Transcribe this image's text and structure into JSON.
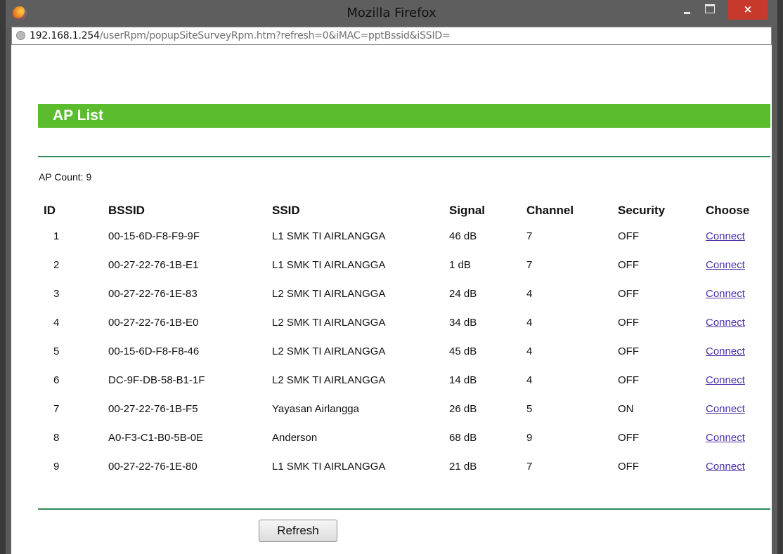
{
  "window": {
    "title": "Mozilla Firefox",
    "close_glyph": "×"
  },
  "urlbar": {
    "host": "192.168.1.254",
    "path": "/userRpm/popupSiteSurveyRpm.htm?refresh=0&iMAC=pptBssid&iSSID="
  },
  "page": {
    "header": "AP List",
    "ap_count": "AP Count: 9",
    "refresh_label": "Refresh",
    "accent_color": "#5bbd2e",
    "rule_color": "#2e8b57"
  },
  "table": {
    "columns": [
      "ID",
      "BSSID",
      "SSID",
      "Signal",
      "Channel",
      "Security",
      "Choose"
    ],
    "rows": [
      {
        "id": "1",
        "bssid": "00-15-6D-F8-F9-9F",
        "ssid": "L1 SMK TI AIRLANGGA",
        "signal": "46 dB",
        "channel": "7",
        "security": "OFF",
        "choose": "Connect"
      },
      {
        "id": "2",
        "bssid": "00-27-22-76-1B-E1",
        "ssid": "L1 SMK TI AIRLANGGA",
        "signal": "1 dB",
        "channel": "7",
        "security": "OFF",
        "choose": "Connect"
      },
      {
        "id": "3",
        "bssid": "00-27-22-76-1E-83",
        "ssid": "L2 SMK TI AIRLANGGA",
        "signal": "24 dB",
        "channel": "4",
        "security": "OFF",
        "choose": "Connect"
      },
      {
        "id": "4",
        "bssid": "00-27-22-76-1B-E0",
        "ssid": "L2 SMK TI AIRLANGGA",
        "signal": "34 dB",
        "channel": "4",
        "security": "OFF",
        "choose": "Connect"
      },
      {
        "id": "5",
        "bssid": "00-15-6D-F8-F8-46",
        "ssid": "L2 SMK TI AIRLANGGA",
        "signal": "45 dB",
        "channel": "4",
        "security": "OFF",
        "choose": "Connect"
      },
      {
        "id": "6",
        "bssid": "DC-9F-DB-58-B1-1F",
        "ssid": "L2 SMK TI AIRLANGGA",
        "signal": "14 dB",
        "channel": "4",
        "security": "OFF",
        "choose": "Connect"
      },
      {
        "id": "7",
        "bssid": "00-27-22-76-1B-F5",
        "ssid": "Yayasan Airlangga",
        "signal": "26 dB",
        "channel": "5",
        "security": "ON",
        "choose": "Connect"
      },
      {
        "id": "8",
        "bssid": "A0-F3-C1-B0-5B-0E",
        "ssid": "Anderson",
        "signal": "68 dB",
        "channel": "9",
        "security": "OFF",
        "choose": "Connect"
      },
      {
        "id": "9",
        "bssid": "00-27-22-76-1E-80",
        "ssid": "L1 SMK TI AIRLANGGA",
        "signal": "21 dB",
        "channel": "7",
        "security": "OFF",
        "choose": "Connect"
      }
    ]
  }
}
